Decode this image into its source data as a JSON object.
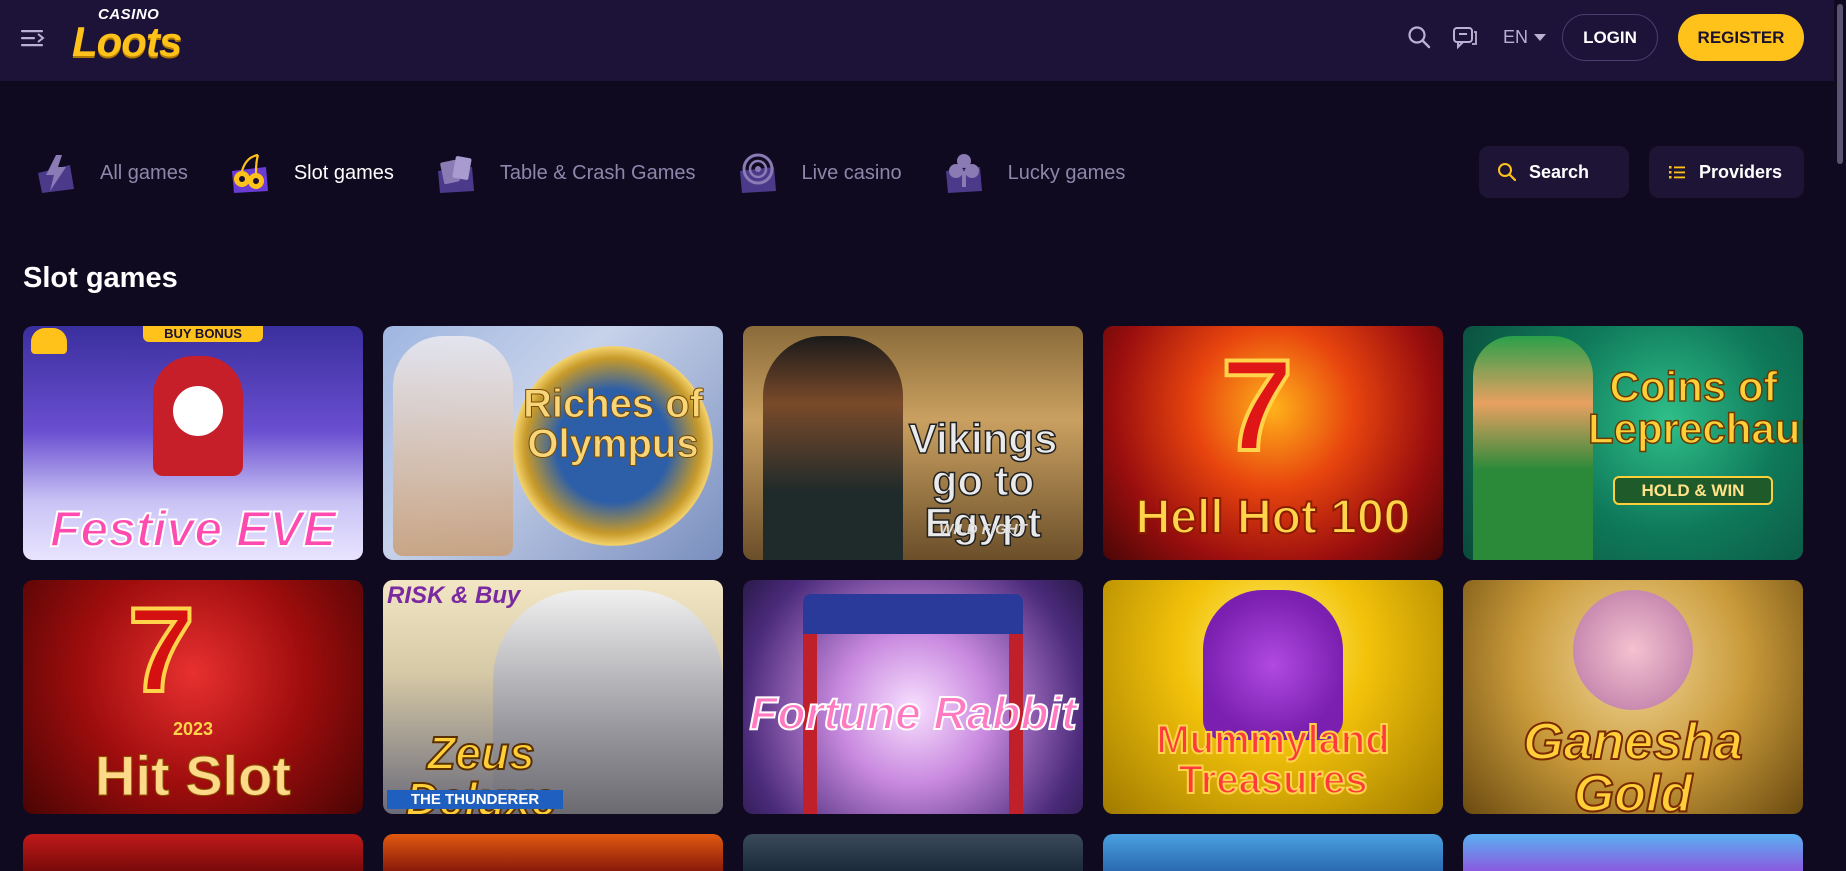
{
  "header": {
    "logo_top": "CASINO",
    "logo_main": "Loots",
    "language": "EN",
    "login_label": "LOGIN",
    "register_label": "REGISTER"
  },
  "categories": [
    {
      "label": "All games",
      "icon": "lightning-icon",
      "active": false
    },
    {
      "label": "Slot games",
      "icon": "cherries-icon",
      "active": true
    },
    {
      "label": "Table & Crash Games",
      "icon": "cards-icon",
      "active": false
    },
    {
      "label": "Live casino",
      "icon": "roulette-icon",
      "active": false
    },
    {
      "label": "Lucky games",
      "icon": "clover-icon",
      "active": false
    }
  ],
  "actions": {
    "search_label": "Search",
    "providers_label": "Providers"
  },
  "section": {
    "title": "Slot games"
  },
  "games": [
    {
      "title": "Festive EVE",
      "badge": "BUY BONUS"
    },
    {
      "title": "Riches of Olympus"
    },
    {
      "title": "Vikings go to Egypt",
      "subtitle": "WILD FIGHT"
    },
    {
      "title": "Hell Hot 100"
    },
    {
      "title": "Coins of Leprechaun",
      "subtitle": "HOLD & WIN"
    },
    {
      "title": "Hit Slot",
      "subtitle": "2023"
    },
    {
      "title": "Zeus Deluxe",
      "subtitle": "THE THUNDERER",
      "badge": "RISK & Buy"
    },
    {
      "title": "Fortune Rabbit"
    },
    {
      "title": "Mummyland Treasures"
    },
    {
      "title": "Ganesha Gold"
    }
  ],
  "colors": {
    "background": "#0f0a1f",
    "topbar": "#1d1238",
    "accent": "#ffc21a",
    "muted_text": "#8f86ab"
  }
}
